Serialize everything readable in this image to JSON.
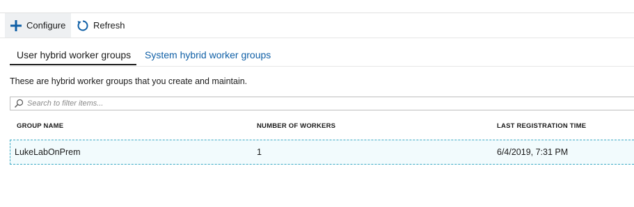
{
  "toolbar": {
    "configure_label": "Configure",
    "refresh_label": "Refresh"
  },
  "tabs": [
    {
      "label": "User hybrid worker groups",
      "active": true
    },
    {
      "label": "System hybrid worker groups",
      "active": false
    }
  ],
  "description": "These are hybrid worker groups that you create and maintain.",
  "filter": {
    "placeholder": "Search to filter items..."
  },
  "table": {
    "columns": [
      "GROUP NAME",
      "NUMBER OF WORKERS",
      "LAST REGISTRATION TIME"
    ],
    "rows": [
      {
        "group_name": "LukeLabOnPrem",
        "workers": "1",
        "last_registration": "6/4/2019, 7:31 PM"
      }
    ]
  },
  "colors": {
    "accent": "#0f5fa6",
    "selection_border": "#3aa9c4",
    "selection_fill": "#f2fbfd"
  }
}
